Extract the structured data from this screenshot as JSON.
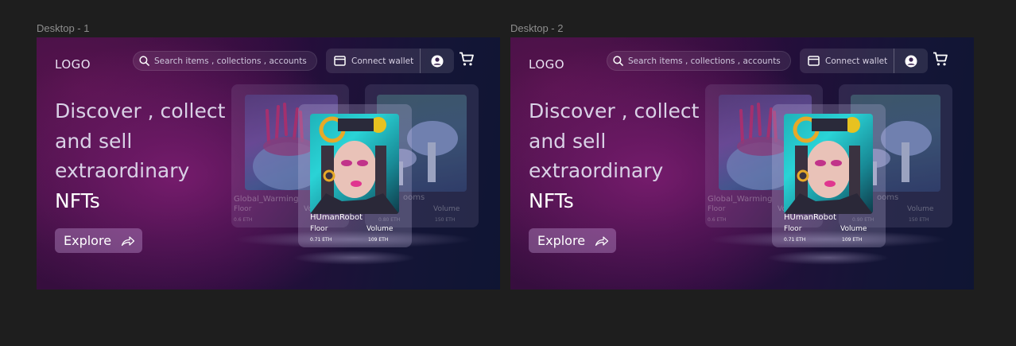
{
  "frames": [
    {
      "label": "Desktop - 1",
      "logo": "LOGO",
      "search_placeholder": "Search items , collections , accounts",
      "connect_wallet": "Connect wallet",
      "headline_lines": [
        "Discover , collect",
        "and sell",
        "extraordinary",
        "NFTs"
      ],
      "explore": "Explore",
      "cards": {
        "left": {
          "title": "Global_Warming",
          "floor_label": "Floor",
          "floor_value": "0.6 ETH",
          "volume_label": "Volume"
        },
        "right": {
          "title": "ooms",
          "floor_value": "0.80 ETH",
          "volume_label": "Volume",
          "volume_value": "150 ETH"
        },
        "front": {
          "title": "HUmanRobot",
          "floor_label": "Floor",
          "floor_value": "0.71 ETH",
          "volume_label": "Volume",
          "volume_value": "109 ETH"
        }
      }
    },
    {
      "label": "Desktop - 2",
      "logo": "LOGO",
      "search_placeholder": "Search items , collections , accounts",
      "connect_wallet": "Connect wallet",
      "headline_lines": [
        "Discover , collect",
        "and sell",
        "extraordinary",
        "NFTs"
      ],
      "explore": "Explore",
      "cards": {
        "left": {
          "title": "Global_Warming",
          "floor_label": "Floor",
          "floor_value": "0.6 ETH",
          "volume_label": "Vo"
        },
        "right": {
          "title": "ooms",
          "floor_value": "0.90 ETH",
          "volume_label": "Volume",
          "volume_value": "150 ETH"
        },
        "front": {
          "title": "HUmanRobot",
          "floor_label": "Floor",
          "floor_value": "0.71 ETH",
          "volume_label": "Volume",
          "volume_value": "109 ETH"
        }
      }
    }
  ],
  "colors": {
    "canvas": "#1e1e1e",
    "accent_pink": "#e0368f",
    "accent_cyan": "#2ad3d6",
    "text_light": "#d9d1e6"
  }
}
